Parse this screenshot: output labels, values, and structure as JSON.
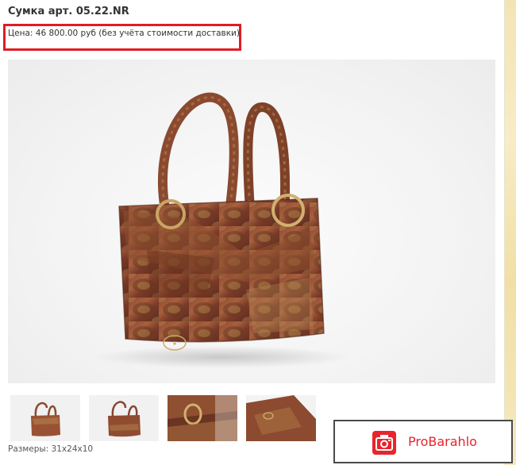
{
  "product": {
    "title": "Сумка арт. 05.22.NR",
    "price_text": "Цена: 46 800.00 руб (без учёта стоимости доставки)",
    "sizes_text": "Размеры: 31x24x10"
  },
  "gallery": {
    "main_image": "python-leather-handbag-photo",
    "thumbnails": [
      "thumb-front-view",
      "thumb-front-view-2",
      "thumb-buckle-closeup",
      "thumb-logo-closeup"
    ]
  },
  "watermark": {
    "brand_text": "ProBarahlo",
    "icon": "camera-icon"
  },
  "colors": {
    "highlight_border": "#e01c24",
    "brand_red": "#e8242c",
    "side_strip": "#f3e4b4"
  }
}
